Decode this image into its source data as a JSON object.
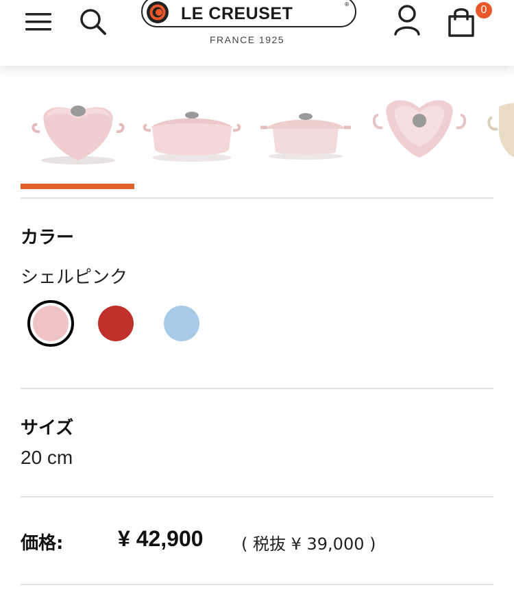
{
  "header": {
    "logo_text": "LE CREUSET",
    "logo_reg": "®",
    "logo_sub": "FRANCE 1925",
    "cart_count": "0",
    "icons": [
      "menu-icon",
      "search-icon",
      "account-icon",
      "cart-icon"
    ]
  },
  "thumbnails": {
    "items": [
      {
        "name": "heart-pot-front",
        "selected": true
      },
      {
        "name": "heart-pot-side",
        "selected": false
      },
      {
        "name": "heart-pot-profile",
        "selected": false
      },
      {
        "name": "heart-pot-top",
        "selected": false
      },
      {
        "name": "heart-pot-cream-partial",
        "selected": false
      }
    ]
  },
  "color": {
    "label": "カラー",
    "selected_name": "シェルピンク",
    "swatches": [
      {
        "name": "shell-pink",
        "color": "#efc3c6",
        "selected": true
      },
      {
        "name": "cherry-red",
        "color": "#c0302b",
        "selected": false
      },
      {
        "name": "light-blue",
        "color": "#a9cbea",
        "selected": false
      }
    ]
  },
  "size": {
    "label": "サイズ",
    "value": "20 cm"
  },
  "price": {
    "label": "価格:",
    "value": "¥ 42,900",
    "tax_excluded": "( 税抜 ¥ 39,000 )"
  },
  "colors": {
    "accent": "#e0632d",
    "badge": "#e8582a"
  }
}
